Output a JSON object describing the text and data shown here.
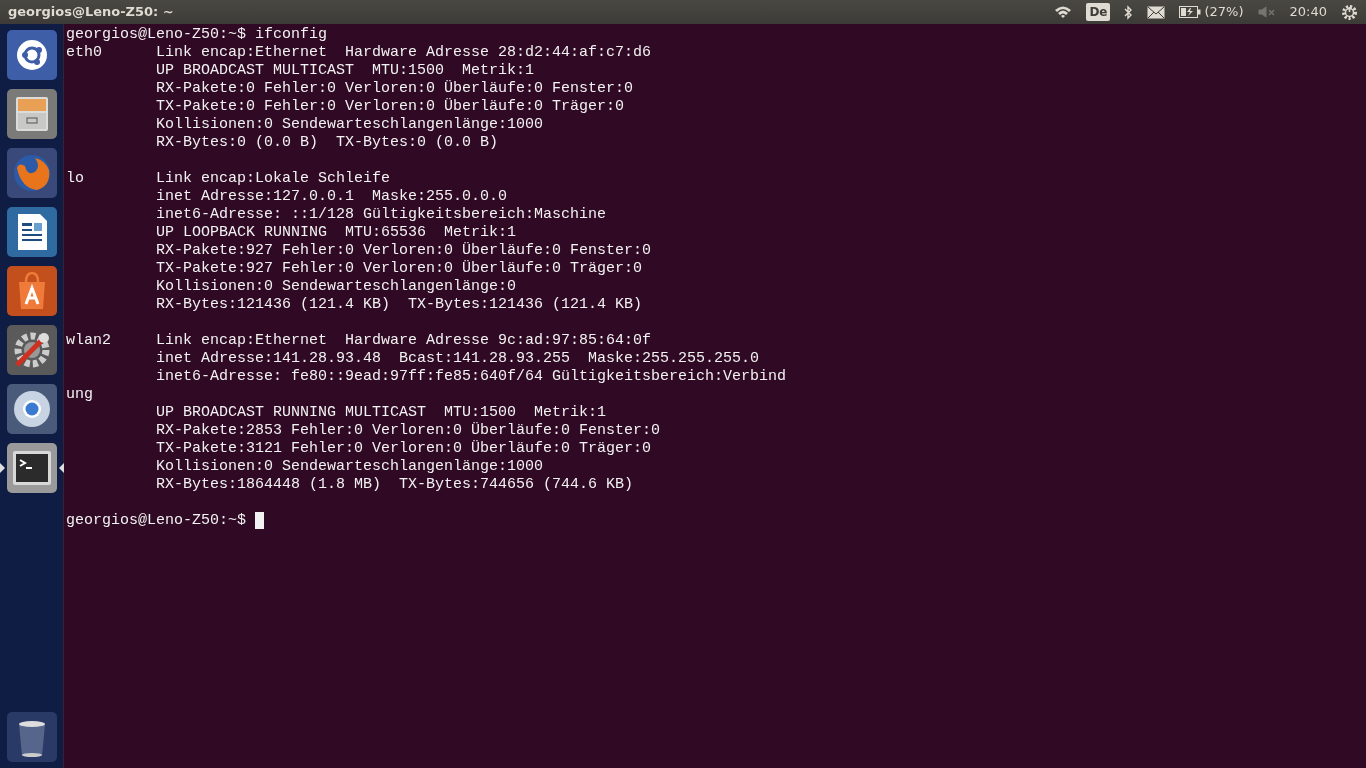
{
  "top_bar": {
    "title": "georgios@Leno-Z50: ~",
    "keyboard_layout": "De",
    "battery": "(27%)",
    "clock": "20:40"
  },
  "launcher": {
    "items": [
      {
        "kind": "dash",
        "running": false,
        "focused": false
      },
      {
        "kind": "files",
        "running": false,
        "focused": false
      },
      {
        "kind": "firefox",
        "running": false,
        "focused": false
      },
      {
        "kind": "writer",
        "running": false,
        "focused": false
      },
      {
        "kind": "software",
        "running": false,
        "focused": false
      },
      {
        "kind": "settings",
        "running": false,
        "focused": false
      },
      {
        "kind": "chromium",
        "running": false,
        "focused": false
      },
      {
        "kind": "terminal",
        "running": true,
        "focused": true
      }
    ],
    "trash": {
      "kind": "trash"
    }
  },
  "terminal": {
    "blocks": [
      [
        "georgios@Leno-Z50:~$ ifconfig",
        "eth0      Link encap:Ethernet  Hardware Adresse 28:d2:44:af:c7:d6",
        "          UP BROADCAST MULTICAST  MTU:1500  Metrik:1",
        "          RX-Pakete:0 Fehler:0 Verloren:0 Überläufe:0 Fenster:0",
        "          TX-Pakete:0 Fehler:0 Verloren:0 Überläufe:0 Träger:0",
        "          Kollisionen:0 Sendewarteschlangenlänge:1000",
        "          RX-Bytes:0 (0.0 B)  TX-Bytes:0 (0.0 B)"
      ],
      [
        "lo        Link encap:Lokale Schleife",
        "          inet Adresse:127.0.0.1  Maske:255.0.0.0",
        "          inet6-Adresse: ::1/128 Gültigkeitsbereich:Maschine",
        "          UP LOOPBACK RUNNING  MTU:65536  Metrik:1",
        "          RX-Pakete:927 Fehler:0 Verloren:0 Überläufe:0 Fenster:0",
        "          TX-Pakete:927 Fehler:0 Verloren:0 Überläufe:0 Träger:0",
        "          Kollisionen:0 Sendewarteschlangenlänge:0",
        "          RX-Bytes:121436 (121.4 KB)  TX-Bytes:121436 (121.4 KB)"
      ],
      [
        "wlan2     Link encap:Ethernet  Hardware Adresse 9c:ad:97:85:64:0f",
        "          inet Adresse:141.28.93.48  Bcast:141.28.93.255  Maske:255.255.255.0",
        "          inet6-Adresse: fe80::9ead:97ff:fe85:640f/64 Gültigkeitsbereich:Verbind",
        "ung",
        "          UP BROADCAST RUNNING MULTICAST  MTU:1500  Metrik:1",
        "          RX-Pakete:2853 Fehler:0 Verloren:0 Überläufe:0 Fenster:0",
        "          TX-Pakete:3121 Fehler:0 Verloren:0 Überläufe:0 Träger:0",
        "          Kollisionen:0 Sendewarteschlangenlänge:1000",
        "          RX-Bytes:1864448 (1.8 MB)  TX-Bytes:744656 (744.6 KB)"
      ],
      [
        "georgios@Leno-Z50:~$ "
      ]
    ],
    "cursor": true
  }
}
